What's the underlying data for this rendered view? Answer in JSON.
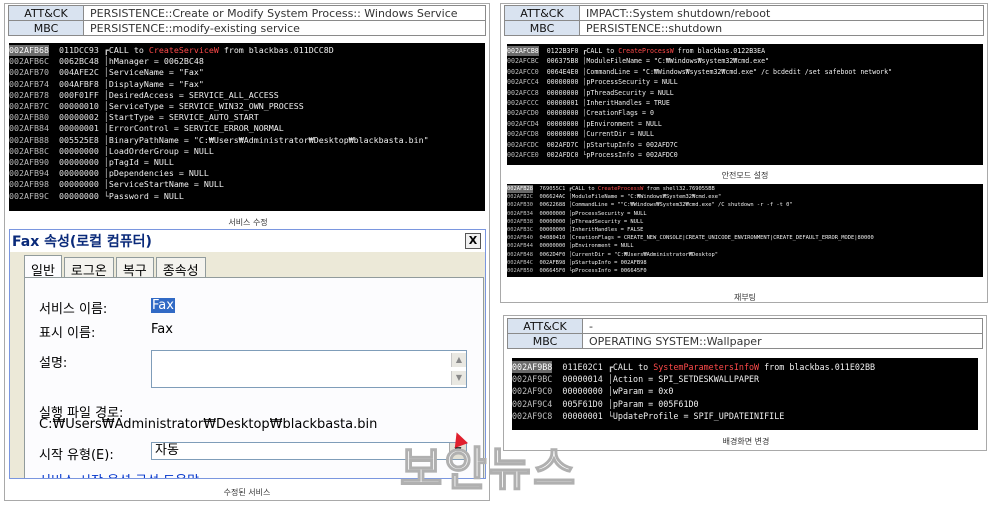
{
  "left_panel": {
    "header": [
      {
        "key": "ATT&CK",
        "value": "PERSISTENCE::Create or Modify System Process:: Windows Service"
      },
      {
        "key": "MBC",
        "value": "PERSISTENCE::modify-existing service"
      }
    ],
    "debugger": [
      {
        "addr": "002AFB68",
        "val": "011DCC93",
        "brk": "┏",
        "pre": "CALL to ",
        "fn": "CreateServiceW",
        "post": " from blackbas.011DCC8D",
        "sel": true
      },
      {
        "addr": "002AFB6C",
        "val": "0062BC48",
        "brk": "│",
        "pre": "hManager = 0062BC48",
        "fn": "",
        "post": ""
      },
      {
        "addr": "002AFB70",
        "val": "004AFE2C",
        "brk": "│",
        "pre": "ServiceName = \"Fax\"",
        "fn": "",
        "post": ""
      },
      {
        "addr": "002AFB74",
        "val": "004AFBF8",
        "brk": "│",
        "pre": "DisplayName = \"Fax\"",
        "fn": "",
        "post": ""
      },
      {
        "addr": "002AFB78",
        "val": "000F01FF",
        "brk": "│",
        "pre": "DesiredAccess = SERVICE_ALL_ACCESS",
        "fn": "",
        "post": ""
      },
      {
        "addr": "002AFB7C",
        "val": "00000010",
        "brk": "│",
        "pre": "ServiceType = SERVICE_WIN32_OWN_PROCESS",
        "fn": "",
        "post": ""
      },
      {
        "addr": "002AFB80",
        "val": "00000002",
        "brk": "│",
        "pre": "StartType = SERVICE_AUTO_START",
        "fn": "",
        "post": ""
      },
      {
        "addr": "002AFB84",
        "val": "00000001",
        "brk": "│",
        "pre": "ErrorControl = SERVICE_ERROR_NORMAL",
        "fn": "",
        "post": ""
      },
      {
        "addr": "002AFB88",
        "val": "005525E8",
        "brk": "│",
        "pre": "BinaryPathName = \"C:₩Users₩Administrator₩Desktop₩blackbasta.bin\"",
        "fn": "",
        "post": ""
      },
      {
        "addr": "002AFB8C",
        "val": "00000000",
        "brk": "│",
        "pre": "LoadOrderGroup = NULL",
        "fn": "",
        "post": ""
      },
      {
        "addr": "002AFB90",
        "val": "00000000",
        "brk": "│",
        "pre": "pTagId = NULL",
        "fn": "",
        "post": ""
      },
      {
        "addr": "002AFB94",
        "val": "00000000",
        "brk": "│",
        "pre": "pDependencies = NULL",
        "fn": "",
        "post": ""
      },
      {
        "addr": "002AFB98",
        "val": "00000000",
        "brk": "│",
        "pre": "ServiceStartName = NULL",
        "fn": "",
        "post": ""
      },
      {
        "addr": "002AFB9C",
        "val": "00000000",
        "brk": "└",
        "pre": "Password = NULL",
        "fn": "",
        "post": ""
      }
    ],
    "caption1": "서비스 수정",
    "dialog": {
      "title": "Fax 속성(로컬 컴퓨터)",
      "close": "X",
      "tabs": [
        "일반",
        "로그온",
        "복구",
        "종속성"
      ],
      "service_name_label": "서비스 이름:",
      "service_name_value": "Fax",
      "display_name_label": "표시 이름:",
      "display_name_value": "Fax",
      "description_label": "설명:",
      "exe_path_label": "실행 파일 경로:",
      "exe_path_value": "C:₩Users₩Administrator₩Desktop₩blackbasta.bin",
      "start_type_label": "시작 유형(E):",
      "start_type_value": "자동",
      "help_link": "서비스 시작 옵션 구성 도움말"
    },
    "caption2": "수정된 서비스"
  },
  "right_top": {
    "header": [
      {
        "key": "ATT&CK",
        "value": "IMPACT::System shutdown/reboot"
      },
      {
        "key": "MBC",
        "value": "PERSISTENCE::shutdown"
      }
    ],
    "debugger1": [
      {
        "addr": "002AFCB8",
        "val": "0122B3F0",
        "brk": "┏",
        "pre": "CALL to ",
        "fn": "CreateProcessW",
        "post": " from blackbas.0122B3EA",
        "sel": true
      },
      {
        "addr": "002AFCBC",
        "val": "006375B8",
        "brk": "│",
        "pre": "ModuleFileName = \"C:₩Windows₩system32₩cmd.exe\"",
        "fn": "",
        "post": ""
      },
      {
        "addr": "002AFCC0",
        "val": "0064E4E0",
        "brk": "│",
        "pre": "CommandLine = \"C:₩Windows₩system32₩cmd.exe\" /c bcdedit /set safeboot network\"",
        "fn": "",
        "post": ""
      },
      {
        "addr": "002AFCC4",
        "val": "00000000",
        "brk": "│",
        "pre": "pProcessSecurity = NULL",
        "fn": "",
        "post": ""
      },
      {
        "addr": "002AFCC8",
        "val": "00000000",
        "brk": "│",
        "pre": "pThreadSecurity = NULL",
        "fn": "",
        "post": ""
      },
      {
        "addr": "002AFCCC",
        "val": "00000001",
        "brk": "│",
        "pre": "InheritHandles = TRUE",
        "fn": "",
        "post": ""
      },
      {
        "addr": "002AFCD0",
        "val": "00000000",
        "brk": "│",
        "pre": "CreationFlags = 0",
        "fn": "",
        "post": ""
      },
      {
        "addr": "002AFCD4",
        "val": "00000000",
        "brk": "│",
        "pre": "pEnvironment = NULL",
        "fn": "",
        "post": ""
      },
      {
        "addr": "002AFCD8",
        "val": "00000000",
        "brk": "│",
        "pre": "CurrentDir = NULL",
        "fn": "",
        "post": ""
      },
      {
        "addr": "002AFCDC",
        "val": "002AFD7C",
        "brk": "│",
        "pre": "pStartupInfo = 002AFD7C",
        "fn": "",
        "post": ""
      },
      {
        "addr": "002AFCE0",
        "val": "002AFDC0",
        "brk": "└",
        "pre": "pProcessInfo = 002AFDC0",
        "fn": "",
        "post": ""
      }
    ],
    "caption1": "안전모드 설정",
    "debugger2": [
      {
        "addr": "002AFB28",
        "val": "769055C1",
        "brk": "┏",
        "pre": "CALL to ",
        "fn": "CreateProcessW",
        "post": " from shell32.769055BB",
        "sel": true
      },
      {
        "addr": "002AFB2C",
        "val": "006624AC",
        "brk": "│",
        "pre": "ModuleFileName = \"C:₩Windows₩System32₩cmd.exe\"",
        "fn": "",
        "post": ""
      },
      {
        "addr": "002AFB30",
        "val": "00622688",
        "brk": "│",
        "pre": "CommandLine = \"\"C:₩Windows₩System32₩cmd.exe\" /C shutdown -r -f -t 0\"",
        "fn": "",
        "post": ""
      },
      {
        "addr": "002AFB34",
        "val": "00000000",
        "brk": "│",
        "pre": "pProcessSecurity = NULL",
        "fn": "",
        "post": ""
      },
      {
        "addr": "002AFB38",
        "val": "00000000",
        "brk": "│",
        "pre": "pThreadSecurity = NULL",
        "fn": "",
        "post": ""
      },
      {
        "addr": "002AFB3C",
        "val": "00000000",
        "brk": "│",
        "pre": "InheritHandles = FALSE",
        "fn": "",
        "post": ""
      },
      {
        "addr": "002AFB40",
        "val": "04080410",
        "brk": "│",
        "pre": "CreationFlags = CREATE_NEW_CONSOLE|CREATE_UNICODE_ENVIRONMENT|CREATE_DEFAULT_ERROR_MODE|80000",
        "fn": "",
        "post": ""
      },
      {
        "addr": "002AFB44",
        "val": "00000000",
        "brk": "│",
        "pre": "pEnvironment = NULL",
        "fn": "",
        "post": ""
      },
      {
        "addr": "002AFB48",
        "val": "0062D4F0",
        "brk": "│",
        "pre": "CurrentDir = \"C:₩Users₩Administrator₩Desktop\"",
        "fn": "",
        "post": ""
      },
      {
        "addr": "002AFB4C",
        "val": "002AFB98",
        "brk": "│",
        "pre": "pStartupInfo = 002AFB98",
        "fn": "",
        "post": ""
      },
      {
        "addr": "002AFB50",
        "val": "006645F0",
        "brk": "└",
        "pre": "pProcessInfo = 006645F0",
        "fn": "",
        "post": ""
      }
    ],
    "caption2": "재부팅"
  },
  "right_bottom": {
    "header": [
      {
        "key": "ATT&CK",
        "value": "-"
      },
      {
        "key": "MBC",
        "value": "OPERATING SYSTEM::Wallpaper"
      }
    ],
    "debugger": [
      {
        "addr": "002AF9B8",
        "val": "011E02C1",
        "brk": "┏",
        "pre": "CALL to ",
        "fn": "SystemParametersInfoW",
        "post": " from blackbas.011E02BB",
        "sel": true
      },
      {
        "addr": "002AF9BC",
        "val": "00000014",
        "brk": "│",
        "pre": "Action = SPI_SETDESKWALLPAPER",
        "fn": "",
        "post": ""
      },
      {
        "addr": "002AF9C0",
        "val": "00000000",
        "brk": "│",
        "pre": "wParam = 0x0",
        "fn": "",
        "post": ""
      },
      {
        "addr": "002AF9C4",
        "val": "005F61D0",
        "brk": "│",
        "pre": "pParam = 005F61D0",
        "fn": "",
        "post": ""
      },
      {
        "addr": "002AF9C8",
        "val": "00000001",
        "brk": "└",
        "pre": "UpdateProfile = SPIF_UPDATEINIFILE",
        "fn": "",
        "post": ""
      }
    ],
    "caption": "배경화면 변경"
  },
  "watermark": "보안뉴스"
}
